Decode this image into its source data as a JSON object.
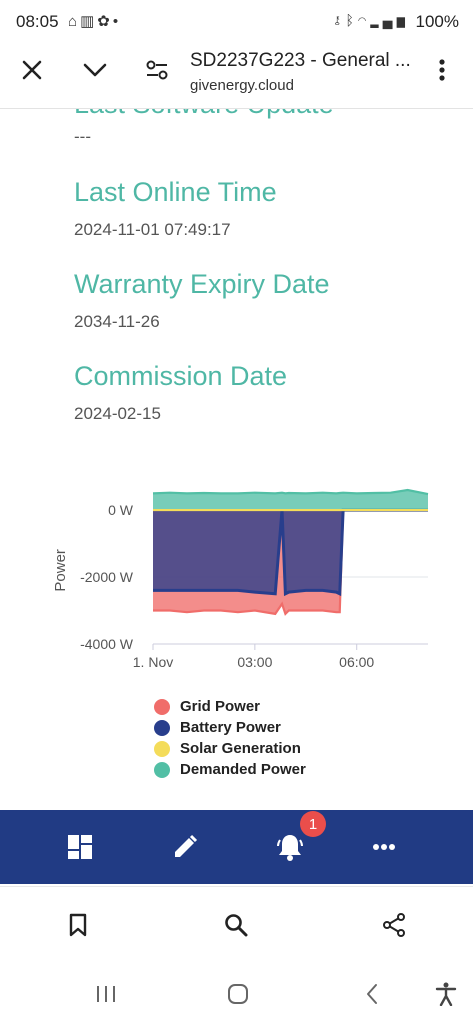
{
  "status_bar": {
    "time": "08:05",
    "battery": "100%",
    "icons_left": [
      "home-icon",
      "grid-icon",
      "flower-icon",
      "dot-icon"
    ],
    "icons_right": [
      "key-icon",
      "bluetooth-icon",
      "wifi-icon",
      "signal-icon"
    ]
  },
  "browser": {
    "title": "SD2237G223 - General ...",
    "domain": "givenergy.cloud"
  },
  "details": [
    {
      "label": "Last Software Update",
      "value": "---"
    },
    {
      "label": "Last Online Time",
      "value": "2024-11-01 07:49:17"
    },
    {
      "label": "Warranty Expiry Date",
      "value": "2034-11-26"
    },
    {
      "label": "Commission Date",
      "value": "2024-02-15"
    }
  ],
  "chart_data": {
    "type": "area",
    "ylabel": "Power",
    "yticks": [
      "0 W",
      "-2000 W",
      "-4000 W"
    ],
    "xticks": [
      "1. Nov",
      "03:00",
      "06:00"
    ],
    "ylim": [
      -4000,
      600
    ],
    "x_hours": [
      0,
      0.5,
      1,
      1.5,
      2,
      2.5,
      3,
      3.6,
      3.8,
      3.9,
      4.0,
      4.5,
      5,
      5.4,
      5.5,
      5.6,
      6,
      6.5,
      7,
      7.5,
      8.1
    ],
    "series": [
      {
        "name": "Grid Power",
        "color": "#f06d6a",
        "values": [
          -3000,
          -3000,
          -3050,
          -3000,
          -3000,
          -3050,
          -3000,
          -3100,
          -2800,
          -3100,
          -3000,
          -3000,
          -3000,
          -3050,
          -3050,
          0,
          0,
          0,
          0,
          0,
          0
        ]
      },
      {
        "name": "Battery Power",
        "color": "#283e8c",
        "values": [
          -2400,
          -2400,
          -2400,
          -2400,
          -2400,
          -2400,
          -2450,
          -2500,
          0,
          -2500,
          -2450,
          -2400,
          -2400,
          -2450,
          -2500,
          0,
          0,
          0,
          0,
          0,
          0
        ]
      },
      {
        "name": "Solar Generation",
        "color": "#f4dc5a",
        "values": [
          0,
          0,
          0,
          0,
          0,
          0,
          0,
          0,
          0,
          0,
          0,
          0,
          0,
          0,
          0,
          0,
          0,
          0,
          0,
          0,
          0
        ]
      },
      {
        "name": "Demanded Power",
        "color": "#52bfa5",
        "values": [
          500,
          520,
          500,
          510,
          500,
          500,
          520,
          500,
          520,
          500,
          510,
          500,
          520,
          500,
          510,
          520,
          500,
          510,
          520,
          600,
          480
        ]
      }
    ]
  },
  "app_nav": {
    "items": [
      "dashboard-icon",
      "edit-icon",
      "bell-icon",
      "more-icon"
    ],
    "notification_count": "1"
  },
  "bottom_bar": {
    "items": [
      "bookmark-icon",
      "search-icon",
      "share-icon"
    ]
  },
  "system_nav": {
    "items": [
      "recents-icon",
      "home-circle-icon",
      "back-icon",
      "accessibility-icon"
    ]
  }
}
